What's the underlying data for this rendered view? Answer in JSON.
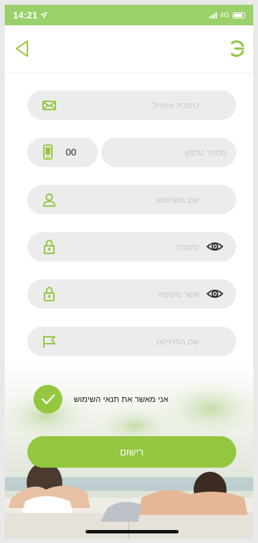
{
  "status_bar": {
    "time": "14:21",
    "network": "4G"
  },
  "form": {
    "email_placeholder": "כתובת אימייל",
    "country_code": "00",
    "phone_placeholder": "מספר טלפון",
    "username_placeholder": "שם משתמש",
    "password_placeholder": "סיסמה",
    "confirm_password_placeholder": "אשר סיסמה",
    "project_placeholder": "שם הפרויקט"
  },
  "terms": {
    "label": "אני מאשר את תנאי השימוש",
    "checked": true
  },
  "register_button": {
    "label": "רישום"
  },
  "colors": {
    "accent": "#93c73f",
    "status_bar": "#9bd16a",
    "field_bg": "#ececec"
  },
  "icons": {
    "back": "back-triangle-icon",
    "logo": "app-logo-icon",
    "email": "envelope-icon",
    "phone": "phone-icon",
    "user": "user-icon",
    "lock": "lock-icon",
    "eye": "eye-icon",
    "flag": "flag-icon",
    "check": "checkmark-icon"
  }
}
